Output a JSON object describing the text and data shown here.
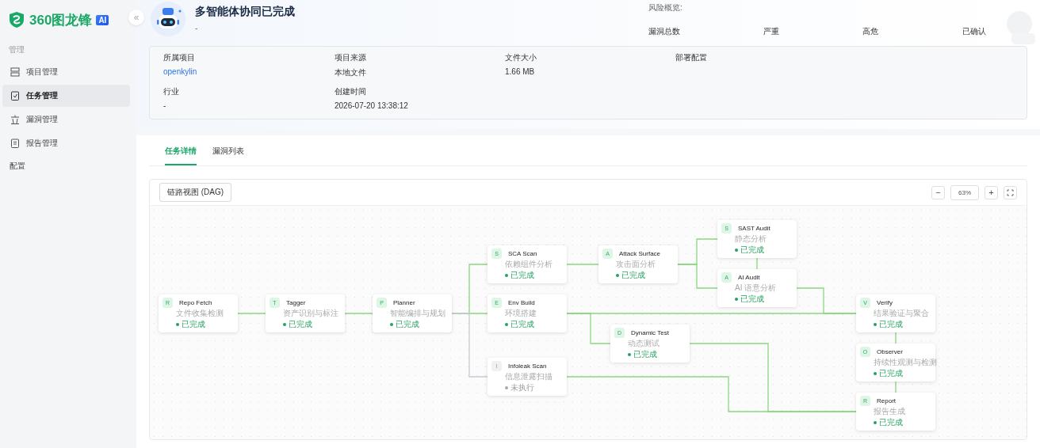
{
  "sidebar": {
    "logo_text": "360图龙锋",
    "logo_badge": "AI",
    "collapse": "«",
    "section": "管理",
    "items": [
      {
        "label": "项目管理",
        "selected": false
      },
      {
        "label": "任务管理",
        "selected": true
      },
      {
        "label": "漏洞管理",
        "selected": false
      },
      {
        "label": "报告管理",
        "selected": false
      }
    ],
    "extra_item": "配置"
  },
  "header": {
    "title": "多智能体协同已完成",
    "subtitle": "-",
    "risk_title": "风险概览:",
    "risk_labels": [
      "漏洞总数",
      "严重",
      "高危",
      "已确认"
    ]
  },
  "info": [
    {
      "label": "所属项目",
      "value": "openkylin",
      "kind": "link"
    },
    {
      "label": "项目来源",
      "value": "本地文件",
      "kind": "text"
    },
    {
      "label": "文件大小",
      "value": "1.66 MB",
      "kind": "text"
    },
    {
      "label": "部署配置"
    },
    {
      "label": "行业",
      "value": "-",
      "kind": "text"
    },
    {
      "label": "创建时间",
      "value": "2026-07-20 13:38:12",
      "kind": "text"
    }
  ],
  "tabs": [
    {
      "label": "任务详情",
      "selected": true
    },
    {
      "label": "漏洞列表",
      "selected": false
    }
  ],
  "dag": {
    "view_button": "链路视图 (DAG)",
    "zoom": "63%",
    "zoom_out": "−",
    "zoom_in": "+",
    "nodes": [
      {
        "badge": "R",
        "title": "Repo Fetch",
        "subtitle": "文件收集检测",
        "status": "已完成",
        "completed": true
      },
      {
        "badge": "T",
        "title": "Tagger",
        "subtitle": "资产识别与标注",
        "status": "已完成",
        "completed": true
      },
      {
        "badge": "P",
        "title": "Planner",
        "subtitle": "智能编排与规划",
        "status": "已完成",
        "completed": true
      },
      {
        "badge": "S",
        "title": "SCA Scan",
        "subtitle": "依赖组件分析",
        "status": "已完成",
        "completed": true
      },
      {
        "badge": "A",
        "title": "Attack Surface",
        "subtitle": "攻击面分析",
        "status": "已完成",
        "completed": true
      },
      {
        "badge": "S",
        "title": "SAST Audit",
        "subtitle": "静态分析",
        "status": "已完成",
        "completed": true
      },
      {
        "badge": "A",
        "title": "AI Audit",
        "subtitle": "AI 语意分析",
        "status": "已完成",
        "completed": true
      },
      {
        "badge": "E",
        "title": "Env Build",
        "subtitle": "环境搭建",
        "status": "已完成",
        "completed": true
      },
      {
        "badge": "D",
        "title": "Dynamic Test",
        "subtitle": "动态测试",
        "status": "已完成",
        "completed": true
      },
      {
        "badge": "I",
        "title": "Infoleak Scan",
        "subtitle": "信息泄露扫描",
        "status": "未执行",
        "completed": false
      },
      {
        "badge": "V",
        "title": "Verify",
        "subtitle": "结果验证与聚合",
        "status": "已完成",
        "completed": true
      },
      {
        "badge": "O",
        "title": "Observer",
        "subtitle": "持续性观测与检测",
        "status": "已完成",
        "completed": true
      },
      {
        "badge": "R",
        "title": "Report",
        "subtitle": "报告生成",
        "status": "已完成",
        "completed": true
      }
    ]
  }
}
